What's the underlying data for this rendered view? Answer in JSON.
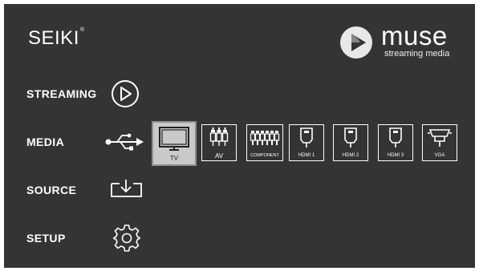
{
  "brand": {
    "name": "SEIKI",
    "reg_mark": "®"
  },
  "muse_logo": {
    "word": "muse",
    "tagline": "streaming media"
  },
  "menu": {
    "items": [
      {
        "label": "STREAMING",
        "icon": "play-circle-icon"
      },
      {
        "label": "MEDIA",
        "icon": "usb-icon"
      },
      {
        "label": "SOURCE",
        "icon": "input-tray-icon"
      },
      {
        "label": "SETUP",
        "icon": "gear-icon"
      }
    ]
  },
  "sources": {
    "selected": "TV",
    "items": [
      {
        "label": "TV",
        "icon": "tv-icon"
      },
      {
        "label": "AV",
        "icon": "av-connector-icon"
      },
      {
        "label": "COMPONENT",
        "icon": "component-connector-icon"
      },
      {
        "label": "HDMI 1",
        "icon": "hdmi-connector-icon"
      },
      {
        "label": "HDMI 2",
        "icon": "hdmi-connector-icon"
      },
      {
        "label": "HDMI 3",
        "icon": "hdmi-connector-icon"
      },
      {
        "label": "VGA",
        "icon": "vga-connector-icon"
      }
    ]
  },
  "colors": {
    "background": "#343434",
    "text": "#ffffff",
    "selected_tile": "#c9c9c9"
  }
}
